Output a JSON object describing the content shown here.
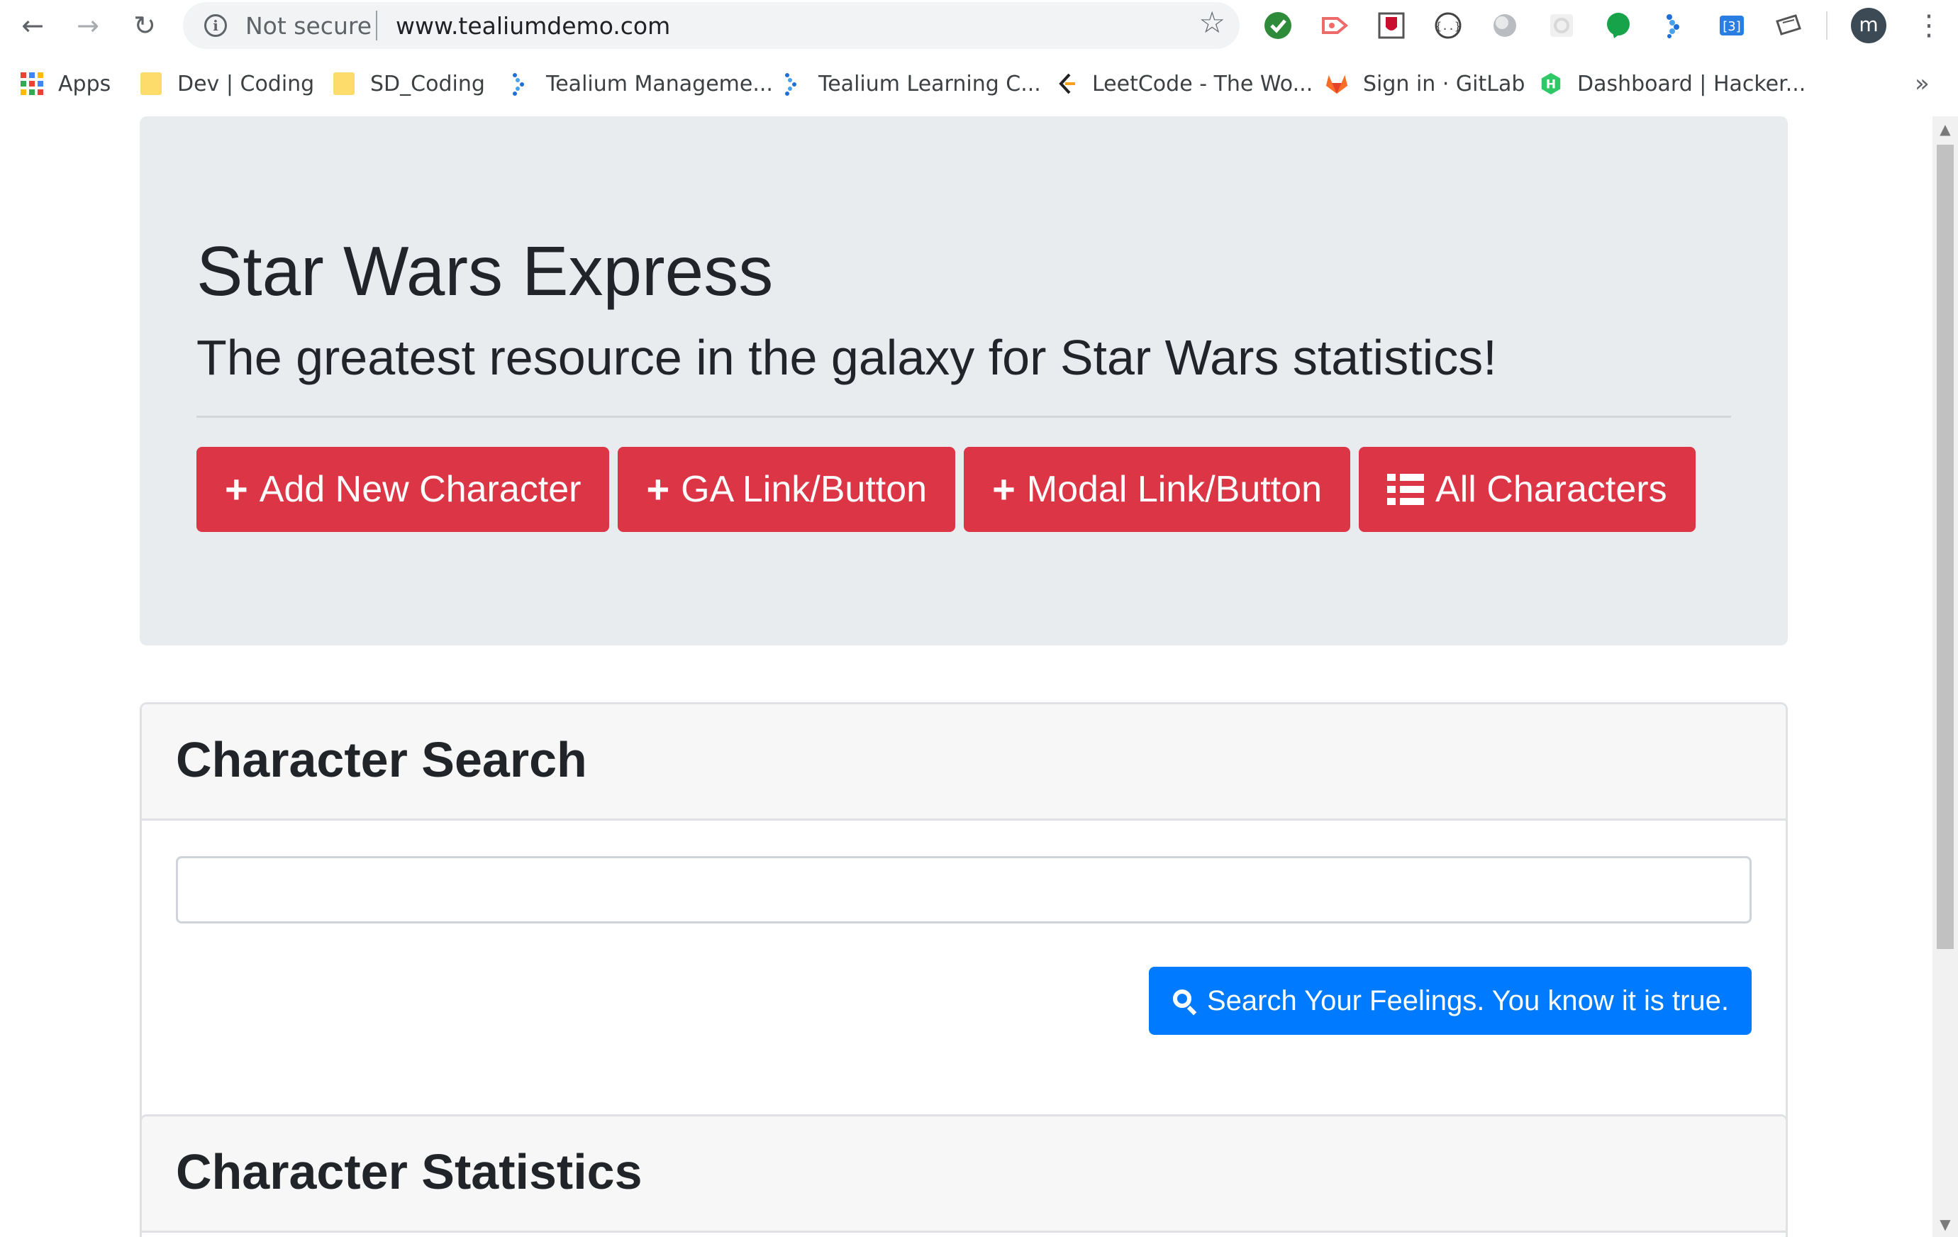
{
  "browser": {
    "security_label": "Not secure",
    "url": "www.tealiumdemo.com",
    "profile_initial": "m",
    "extensions": [
      "check-circle-icon",
      "tag-arrow-icon",
      "shield-icon",
      "braces-icon",
      "circle-icon",
      "gear-icon",
      "chat-bubble-icon",
      "tealium-icon",
      "bracket-box-icon",
      "ticket-icon"
    ]
  },
  "bookmarks": [
    {
      "label": "Apps",
      "icon": "apps-grid-icon"
    },
    {
      "label": "Dev | Coding",
      "icon": "folder-icon"
    },
    {
      "label": "SD_Coding",
      "icon": "folder-icon"
    },
    {
      "label": "Tealium Manageme...",
      "icon": "tealium-icon"
    },
    {
      "label": "Tealium Learning C...",
      "icon": "tealium-icon"
    },
    {
      "label": "LeetCode - The Wo...",
      "icon": "leetcode-icon"
    },
    {
      "label": "Sign in · GitLab",
      "icon": "gitlab-icon"
    },
    {
      "label": "Dashboard | Hacker...",
      "icon": "hackerrank-icon"
    }
  ],
  "jumbotron": {
    "title": "Star Wars Express",
    "lead": "The greatest resource in the galaxy for Star Wars statistics!",
    "buttons": [
      {
        "label": "Add New Character",
        "icon": "plus-icon"
      },
      {
        "label": "GA Link/Button",
        "icon": "plus-icon"
      },
      {
        "label": "Modal Link/Button",
        "icon": "plus-icon"
      },
      {
        "label": "All Characters",
        "icon": "list-icon"
      }
    ]
  },
  "search_card": {
    "title": "Character Search",
    "input_value": "",
    "button_label": "Search Your Feelings. You know it is true."
  },
  "stats_card": {
    "title": "Character Statistics"
  },
  "colors": {
    "danger": "#dc3545",
    "primary": "#007bff",
    "jumbotron_bg": "#e9ecef"
  }
}
